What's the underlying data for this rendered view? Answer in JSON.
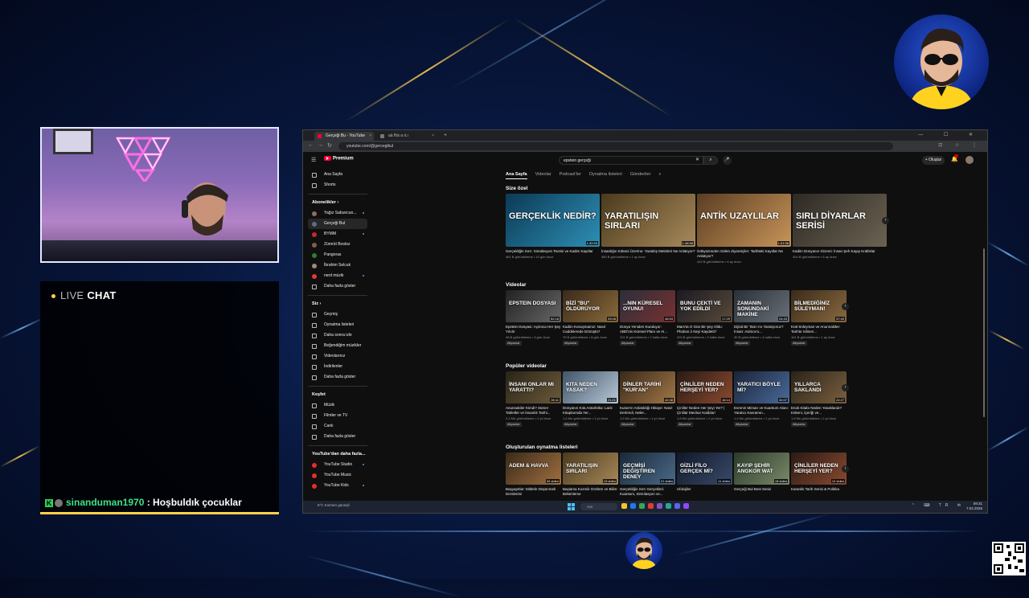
{
  "chat": {
    "live": "LIVE",
    "chat": "CHAT",
    "msg_user": "sinanduman1970",
    "msg_sep": " : ",
    "msg_text": "Hoşbuldık çocuklar"
  },
  "browser": {
    "tabs": [
      {
        "label": "Gerçeği Bu - YouTube",
        "x": "×"
      },
      {
        "label": "aä ffıä a ıt.ı",
        "x": "×"
      }
    ],
    "new_tab": "+",
    "window_controls": "— ☐ ✕",
    "url": "youtube.com/@gercegibul",
    "addr_icons": "⊡ ☆ ⋮"
  },
  "youtube": {
    "menu": "☰",
    "logo": "Premium",
    "search_value": "epstein gerçeği",
    "search_clear": "✕",
    "search_icon": "⌕",
    "mic_icon": "🎤",
    "create_label": "+ Oluştur",
    "bell_icon": "🔔",
    "sidebar": {
      "main": [
        {
          "label": "Ana Sayfa"
        },
        {
          "label": "Shorts"
        }
      ],
      "subs_head": "Abonelikler  ›",
      "subs": [
        {
          "label": "Yağız Sabuncuo...",
          "color": "#8d6e63"
        },
        {
          "label": "Gerçeği Bul",
          "color": "#5f6b8a"
        },
        {
          "label": "BYMM",
          "color": "#c62828"
        },
        {
          "label": "Zümrüt Bostoz",
          "color": "#7b5e57"
        },
        {
          "label": "Pangoras",
          "color": "#2e7d32"
        },
        {
          "label": "İbrahim Selcuk",
          "color": "#a1887f"
        },
        {
          "label": "nerd müzik",
          "color": "#e53935"
        }
      ],
      "subs_more": "Daha fazla göster",
      "you_head": "Siz  ›",
      "you": [
        {
          "label": "Geçmiş"
        },
        {
          "label": "Oynatma listeleri"
        },
        {
          "label": "Daha sonra izle"
        },
        {
          "label": "Beğendiğim müzikler"
        },
        {
          "label": "Videolarınız"
        },
        {
          "label": "İndirilenler"
        }
      ],
      "you_more": "Daha fazla göster",
      "explore_head": "Keşfet",
      "explore": [
        {
          "label": "Müzik"
        },
        {
          "label": "Filmler ve TV"
        },
        {
          "label": "Canlı"
        }
      ],
      "explore_more": "Daha fazla göster",
      "more_head": "YouTube'dan daha fazla...",
      "more": [
        {
          "label": "YouTube Studio"
        },
        {
          "label": "YouTube Music"
        },
        {
          "label": "YouTube Kids"
        }
      ]
    },
    "channel_tabs": [
      "Ana Sayfa",
      "Videolar",
      "Podcast'ler",
      "Oynatma listeleri",
      "Gönderiler",
      "⌕"
    ],
    "sections": {
      "size_ozel": {
        "title": "Size özel",
        "cards": [
          {
            "thumb": "GERÇEKLİK NEDİR?",
            "dur": "1:32:53",
            "title": "Gerçekliğin Sırrı: Simülasyon Teorisi ve Kadim Kayıtlar",
            "meta": "461 B görüntüleme • 10 gün önce",
            "c1": "#0b3a55",
            "c2": "#2e8fb5"
          },
          {
            "thumb": "YARATILIŞIN SIRLARI",
            "dur": "1:46:58",
            "title": "İnsanlığın Kökeni Üzerine: Yaratılış Metinleri Ne Anlatıyor?",
            "meta": "380 B görüntüleme • 1 ay önce",
            "c1": "#4a3a1d",
            "c2": "#a8895a"
          },
          {
            "thumb": "ANTİK UZAYLILAR",
            "dur": "1:01:58",
            "title": "Gökyüzünden Gelen Ziyaretçiler: Tarihteki Kayıtlar Ne Anlatıyor?",
            "meta": "442 B görüntüleme • 6 ay önce",
            "c1": "#5a3e22",
            "c2": "#c8945a"
          },
          {
            "thumb": "SIRLI DİYARLAR SERİSİ",
            "dur": "",
            "title": "Kadim Dünyanın Gizemi: İnsan Şeh Kayıp Krallıklar",
            "meta": "404 B görüntüleme • 6 ay önce",
            "c1": "#2d2a24",
            "c2": "#6b6252"
          }
        ]
      },
      "videolar": {
        "title": "Videolar",
        "cards": [
          {
            "thumb": "EPSTEIN DOSYASI",
            "dur": "52:18",
            "title": "Epstein Dosyası: Açılınca Her Şey Yıkılır",
            "meta": "46 B görüntüleme • 3 gün önce",
            "tag": "Altyazılar",
            "c1": "#222",
            "c2": "#666"
          },
          {
            "thumb": "BİZİ \"BU\" ÖLDÜRÜYOR",
            "dur": "39:08",
            "title": "Kadim Konuşmamız: Nasıl Caddelerede Dönüştü?",
            "meta": "76 B görüntüleme • 8 gün önce",
            "tag": "Altyazılar",
            "c1": "#3a2a1a",
            "c2": "#8a6a3a"
          },
          {
            "thumb": "...NIN KÜRESEL OYUNU!",
            "dur": "45:53",
            "title": "Dünya Yeniden Kuruluyor: ABD'nin Küresel Planı ve AI...",
            "meta": "101 B görüntüleme • 2 hafta önce",
            "tag": "Altyazılar",
            "c1": "#2a2f3a",
            "c2": "#7a3030"
          },
          {
            "thumb": "BUNU ÇEKTİ VE YOK EDİLDİ",
            "dur": "17:29",
            "title": "Mars'ta O Gün Bir Şey Oldu: Phobos 2 Neyi Kaydetti?",
            "meta": "403 B görüntüleme • 3 hafta önce",
            "tag": "Altyazılar",
            "c1": "#1a1a22",
            "c2": "#5a4a3a"
          },
          {
            "thumb": "ZAMANIN SONUNDAKİ MAKİNE",
            "dur": "24:43",
            "title": "Dijital Bir Tanrı mı Yaratıyoruz? İnsan: Asimov'u...",
            "meta": "30 B görüntüleme • 4 hafta önce",
            "tag": "Altyazılar",
            "c1": "#2a3038",
            "c2": "#6a7078"
          },
          {
            "thumb": "BİLMEDİĞİNİZ SÜLEYMAN!",
            "dur": "37:40",
            "title": "Kral Süleyman ve Anunnakiler: Tarihte Silinen...",
            "meta": "161 B görüntüleme • 1 ay önce",
            "tag": "Altyazılar",
            "c1": "#3a2a18",
            "c2": "#8a6a40"
          }
        ]
      },
      "populer": {
        "title": "Popüler videolar",
        "cards": [
          {
            "thumb": "İNSANI ONLAR MI YARATTI?",
            "dur": "35:11",
            "title": "Anunnakiler Kimdi? Sümer Tabletler ve İnsanlık Tarihi...",
            "meta": "2,4 Mn görüntüleme • 2 yıl önce",
            "tag": "Altyazılar",
            "c1": "#2a2418",
            "c2": "#6a5a3a"
          },
          {
            "thumb": "KITA NEDEN YASAK?",
            "dur": "21:21",
            "title": "Dünyanın Kıta Antarktika: Lanlı Kitaplarında Yer...",
            "meta": "1,6 Mn görüntüleme • 1 yıl önce",
            "tag": "Altyazılar",
            "c1": "#405468",
            "c2": "#b8c8d8"
          },
          {
            "thumb": "DİNLER TARİHİ \"KUR'AN\"",
            "dur": "42:38",
            "title": "Kuran'ın Anlatıldığı Hikaye: Nasıl Derlendi, Neler...",
            "meta": "1,5 Mn görüntüleme • 1 yıl önce",
            "tag": "Altyazılar",
            "c1": "#3a2818",
            "c2": "#a07848"
          },
          {
            "thumb": "ÇİNLİLER NEDEN HERŞEYİ YER?",
            "dur": "16:14",
            "title": "Çinliler Neden Her Şeyi Yer? | Çinlilar Mecbur Kaldılar!",
            "meta": "1,8 Mn görüntüleme • 2 yıl önce",
            "tag": "Altyazılar",
            "c1": "#2a1a14",
            "c2": "#8a4a30"
          },
          {
            "thumb": "YARATICI BÖYLE Mİ?",
            "dur": "32:07",
            "title": "Evrenin Mimarı ve Kuantum Alanı: Yaratıcı Kavramın...",
            "meta": "1,4 Mn görüntüleme • 1 yıl önce",
            "tag": "Altyazılar",
            "c1": "#1a2438",
            "c2": "#4a6a9a"
          },
          {
            "thumb": "YILLARCA SAKLANDI",
            "dur": "22:27",
            "title": "Enok Kitabı Neden Yasaklandı? Kökeni, İçeriği ve...",
            "meta": "1,6 Mn görüntüleme • 2 yıl önce",
            "tag": "Altyazılar",
            "c1": "#2a2218",
            "c2": "#7a6040"
          }
        ]
      },
      "playlists": {
        "title": "Oluşturulan oynatma listeleri",
        "cards": [
          {
            "thumb": "ADEM & HAVVA",
            "dur": "34 video",
            "title": "Başyapıtlar: Mitlerle Düşünmek Derslerimi",
            "c1": "#3a2a1a",
            "c2": "#a07040"
          },
          {
            "thumb": "YARATILIŞIN SIRLARI",
            "dur": "13 video",
            "title": "Başlama Kozmik Gözlem ve Bilim: Bölümleme",
            "c1": "#4a3a1d",
            "c2": "#a8895a"
          },
          {
            "thumb": "GEÇMİŞİ DEĞİŞTİREN DENEY",
            "dur": "21 video",
            "title": "Gerçekliğin Sırrı Gerçekleri: Kuantum, Simülasyon ve...",
            "c1": "#1a2838",
            "c2": "#4a6a88"
          },
          {
            "thumb": "GİZLİ FİLO GERÇEK Mİ?",
            "dur": "11 video",
            "title": "Ufolojiler",
            "c1": "#101828",
            "c2": "#3a4a6a"
          },
          {
            "thumb": "KAYIP ŞEHİR ANGKOR WAT",
            "dur": "18 video",
            "title": "Gerçeği Bul Best Serisi",
            "c1": "#2a3a2a",
            "c2": "#7a8a6a"
          },
          {
            "thumb": "ÇİNLİLER NEDEN HERŞEYİ YER?",
            "dur": "12 video",
            "title": "Karanlık Tarih Serisi & Politika",
            "c1": "#2a1a14",
            "c2": "#8a4a30"
          }
        ]
      }
    }
  },
  "taskbar": {
    "weather": "8°C Kısmen güneşli",
    "search": "Ara",
    "clock_time": "09:31",
    "clock_date": "7.02.2026",
    "tray": "⌃ ⌨ TR ✉"
  }
}
